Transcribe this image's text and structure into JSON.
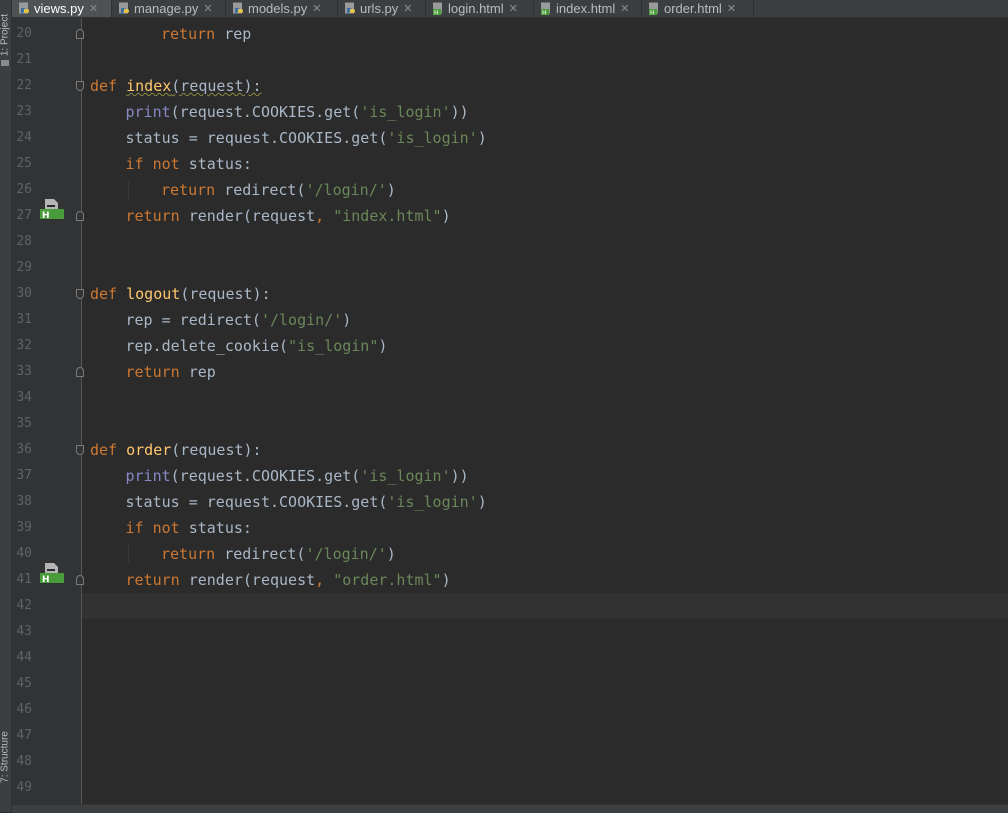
{
  "side_panel": {
    "project_label": "1: Project",
    "structure_label": "7: Structure"
  },
  "tabs": [
    {
      "label": "views.py",
      "type": "python",
      "active": true
    },
    {
      "label": "manage.py",
      "type": "python",
      "active": false
    },
    {
      "label": "models.py",
      "type": "python",
      "active": false
    },
    {
      "label": "urls.py",
      "type": "python",
      "active": false
    },
    {
      "label": "login.html",
      "type": "html",
      "active": false
    },
    {
      "label": "index.html",
      "type": "html",
      "active": false
    },
    {
      "label": "order.html",
      "type": "html",
      "active": false
    }
  ],
  "editor": {
    "current_line": 42,
    "lines": [
      {
        "num": "20",
        "indent": 2,
        "tokens": [
          [
            "kw",
            "return"
          ],
          [
            "t",
            " rep"
          ]
        ]
      },
      {
        "num": "21",
        "indent": 0,
        "tokens": []
      },
      {
        "num": "22",
        "indent": 0,
        "tokens": [
          [
            "kw",
            "def"
          ],
          [
            "t",
            " "
          ],
          [
            "fnsq",
            "index"
          ],
          [
            "sq",
            "(request):"
          ]
        ]
      },
      {
        "num": "23",
        "indent": 1,
        "tokens": [
          [
            "bi",
            "print"
          ],
          [
            "t",
            "(request.COOKIES.get("
          ],
          [
            "str",
            "'is_login'"
          ],
          [
            "t",
            "))"
          ]
        ]
      },
      {
        "num": "24",
        "indent": 1,
        "tokens": [
          [
            "t",
            "status = request.COOKIES.get("
          ],
          [
            "str",
            "'is_login'"
          ],
          [
            "t",
            ")"
          ]
        ]
      },
      {
        "num": "25",
        "indent": 1,
        "tokens": [
          [
            "kw",
            "if not"
          ],
          [
            "t",
            " status:"
          ]
        ]
      },
      {
        "num": "26",
        "indent": 2,
        "tokens": [
          [
            "kw",
            "return"
          ],
          [
            "t",
            " redirect("
          ],
          [
            "str",
            "'/login/'"
          ],
          [
            "t",
            ")"
          ]
        ]
      },
      {
        "num": "27",
        "indent": 1,
        "tokens": [
          [
            "kw",
            "return"
          ],
          [
            "t",
            " render(request"
          ],
          [
            "kw",
            ","
          ],
          [
            "t",
            " "
          ],
          [
            "str",
            "\"index.html\""
          ],
          [
            "t",
            ")"
          ]
        ]
      },
      {
        "num": "28",
        "indent": 0,
        "tokens": []
      },
      {
        "num": "29",
        "indent": 0,
        "tokens": []
      },
      {
        "num": "30",
        "indent": 0,
        "tokens": [
          [
            "kw",
            "def"
          ],
          [
            "t",
            " "
          ],
          [
            "fn",
            "logout"
          ],
          [
            "t",
            "(request):"
          ]
        ]
      },
      {
        "num": "31",
        "indent": 1,
        "tokens": [
          [
            "t",
            "rep = redirect("
          ],
          [
            "str",
            "'/login/'"
          ],
          [
            "t",
            ")"
          ]
        ]
      },
      {
        "num": "32",
        "indent": 1,
        "tokens": [
          [
            "t",
            "rep.delete_cookie("
          ],
          [
            "str",
            "\"is_login\""
          ],
          [
            "t",
            ")"
          ]
        ]
      },
      {
        "num": "33",
        "indent": 1,
        "tokens": [
          [
            "kw",
            "return"
          ],
          [
            "t",
            " rep"
          ]
        ]
      },
      {
        "num": "34",
        "indent": 0,
        "tokens": []
      },
      {
        "num": "35",
        "indent": 0,
        "tokens": []
      },
      {
        "num": "36",
        "indent": 0,
        "tokens": [
          [
            "kw",
            "def"
          ],
          [
            "t",
            " "
          ],
          [
            "fn",
            "order"
          ],
          [
            "t",
            "(request):"
          ]
        ]
      },
      {
        "num": "37",
        "indent": 1,
        "tokens": [
          [
            "bi",
            "print"
          ],
          [
            "t",
            "(request.COOKIES.get("
          ],
          [
            "str",
            "'is_login'"
          ],
          [
            "t",
            "))"
          ]
        ]
      },
      {
        "num": "38",
        "indent": 1,
        "tokens": [
          [
            "t",
            "status = request.COOKIES.get("
          ],
          [
            "str",
            "'is_login'"
          ],
          [
            "t",
            ")"
          ]
        ]
      },
      {
        "num": "39",
        "indent": 1,
        "tokens": [
          [
            "kw",
            "if not"
          ],
          [
            "t",
            " status:"
          ]
        ]
      },
      {
        "num": "40",
        "indent": 2,
        "tokens": [
          [
            "kw",
            "return"
          ],
          [
            "t",
            " redirect("
          ],
          [
            "str",
            "'/login/'"
          ],
          [
            "t",
            ")"
          ]
        ]
      },
      {
        "num": "41",
        "indent": 1,
        "tokens": [
          [
            "kw",
            "return"
          ],
          [
            "t",
            " render(request"
          ],
          [
            "kw",
            ","
          ],
          [
            "t",
            " "
          ],
          [
            "str",
            "\"order.html\""
          ],
          [
            "t",
            ")"
          ]
        ]
      },
      {
        "num": "42",
        "indent": 0,
        "tokens": []
      },
      {
        "num": "43",
        "indent": 0,
        "tokens": []
      },
      {
        "num": "44",
        "indent": 0,
        "tokens": []
      },
      {
        "num": "45",
        "indent": 0,
        "tokens": []
      },
      {
        "num": "46",
        "indent": 0,
        "tokens": []
      },
      {
        "num": "47",
        "indent": 0,
        "tokens": []
      },
      {
        "num": "48",
        "indent": 0,
        "tokens": []
      },
      {
        "num": "49",
        "indent": 0,
        "tokens": []
      }
    ],
    "fold_markers": [
      {
        "line": "20",
        "kind": "close"
      },
      {
        "line": "22",
        "kind": "open"
      },
      {
        "line": "27",
        "kind": "close"
      },
      {
        "line": "30",
        "kind": "open"
      },
      {
        "line": "33",
        "kind": "close"
      },
      {
        "line": "36",
        "kind": "open"
      },
      {
        "line": "41",
        "kind": "close"
      }
    ],
    "gutter_icons": [
      {
        "line": "27",
        "icon": "html-template-link-icon"
      },
      {
        "line": "41",
        "icon": "html-template-link-icon"
      }
    ]
  },
  "colors": {
    "background": "#2b2b2b",
    "keyword": "#cc7832",
    "function_name": "#ffc66d",
    "builtin": "#8888c6",
    "string": "#6a8759",
    "text": "#a9b7c6",
    "line_number": "#606366",
    "html_icon_green": "#4a9c3a"
  }
}
